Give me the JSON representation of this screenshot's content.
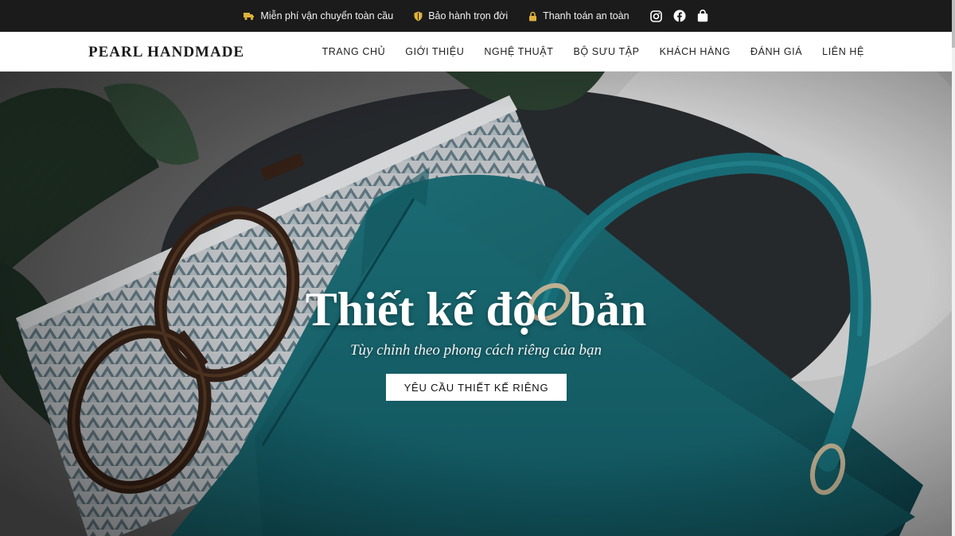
{
  "topbar": {
    "features": [
      {
        "icon": "truck-icon",
        "label": "Miễn phí vận chuyển toàn cầu"
      },
      {
        "icon": "shield-icon",
        "label": "Bảo hành trọn đời"
      },
      {
        "icon": "lock-icon",
        "label": "Thanh toán an toàn"
      }
    ],
    "socials": [
      "instagram-icon",
      "facebook-icon",
      "shopping-bag-icon"
    ],
    "icon_color": "#e0b23a"
  },
  "header": {
    "logo": "PEARL HANDMADE",
    "nav": [
      "TRANG CHỦ",
      "GIỚI THIỆU",
      "NGHỆ THUẬT",
      "BỘ SƯU TẬP",
      "KHÁCH HÀNG",
      "ĐÁNH GIÁ",
      "LIÊN HỆ"
    ]
  },
  "hero": {
    "title": "Thiết kế độc bản",
    "subtitle": "Tùy chỉnh theo phong cách riêng của bạn",
    "button": "YÊU CẦU THIẾT KẾ RIÊNG",
    "bag_color": "#1f6e78"
  }
}
